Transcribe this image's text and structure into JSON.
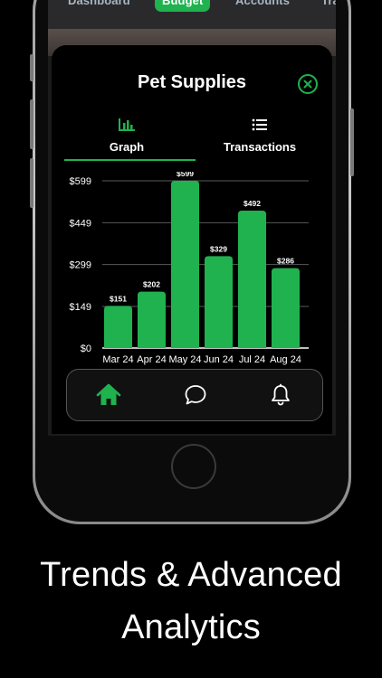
{
  "nav": {
    "items": [
      {
        "label": "Dashboard",
        "active": false
      },
      {
        "label": "Budget",
        "active": true
      },
      {
        "label": "Accounts",
        "active": false
      },
      {
        "label": "Tra",
        "active": false
      }
    ]
  },
  "modal": {
    "title": "Pet Supplies",
    "tabs": [
      {
        "label": "Graph",
        "icon": "bar-chart-icon",
        "active": true
      },
      {
        "label": "Transactions",
        "icon": "list-icon",
        "active": false
      }
    ]
  },
  "chart_data": {
    "type": "bar",
    "categories": [
      "Mar 24",
      "Apr 24",
      "May 24",
      "Jun 24",
      "Jul 24",
      "Aug 24"
    ],
    "values": [
      151,
      202,
      599,
      329,
      492,
      286
    ],
    "data_labels": [
      "$151",
      "$202",
      "$599",
      "$329",
      "$492",
      "$286"
    ],
    "yticks": [
      0,
      149,
      299,
      449,
      599
    ],
    "ytick_labels": [
      "$0",
      "$149",
      "$299",
      "$449",
      "$599"
    ],
    "ylim": [
      0,
      599
    ],
    "grid": true,
    "bar_color": "#1fb24f"
  },
  "tabbar": {
    "items": [
      {
        "icon": "home-icon",
        "active": true
      },
      {
        "icon": "chat-icon",
        "active": false
      },
      {
        "icon": "bell-icon",
        "active": false
      }
    ]
  },
  "headline": {
    "line1": "Trends & Advanced",
    "line2": "Analytics"
  },
  "colors": {
    "accent": "#1fb24f",
    "background": "#000000",
    "nav_text": "#a9b6c4"
  }
}
